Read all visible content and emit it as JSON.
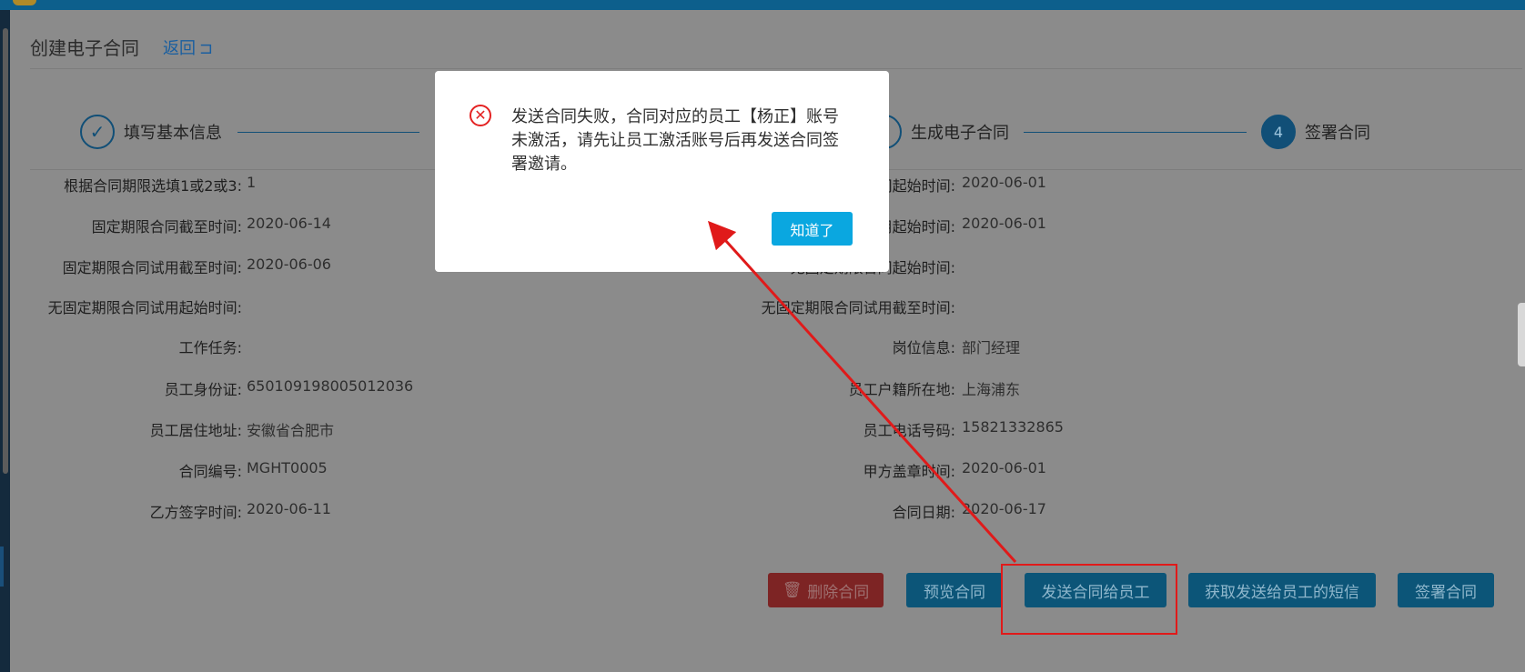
{
  "header": {
    "title": "创建电子合同",
    "back_label": "返回",
    "back_icon": "return-icon"
  },
  "steps": [
    {
      "label": "填写基本信息",
      "state": "done"
    },
    {
      "label": "生成电子合同",
      "state": "done"
    },
    {
      "label": "签署合同",
      "number": "4",
      "state": "active"
    }
  ],
  "form": {
    "left": [
      {
        "label": "根据合同期限选填1或2或3:",
        "value": "1"
      },
      {
        "label": "固定期限合同截至时间:",
        "value": "2020-06-14"
      },
      {
        "label": "固定期限合同试用截至时间:",
        "value": "2020-06-06"
      },
      {
        "label": "无固定期限合同试用起始时间:",
        "value": ""
      },
      {
        "label": "工作任务:",
        "value": ""
      },
      {
        "label": "员工身份证:",
        "value": "650109198005012036"
      },
      {
        "label": "员工居住地址:",
        "value": "安徽省合肥市"
      },
      {
        "label": "合同编号:",
        "value": "MGHT0005"
      },
      {
        "label": "乙方签字时间:",
        "value": "2020-06-11"
      }
    ],
    "right": [
      {
        "label": "期限合同起始时间:",
        "value": "2020-06-01"
      },
      {
        "label": "合同试用起始时间:",
        "value": "2020-06-01"
      },
      {
        "label": "无固定期限合同起始时间:",
        "value": ""
      },
      {
        "label": "无固定期限合同试用截至时间:",
        "value": ""
      },
      {
        "label": "岗位信息:",
        "value": "部门经理"
      },
      {
        "label": "员工户籍所在地:",
        "value": "上海浦东"
      },
      {
        "label": "员工电话号码:",
        "value": "15821332865"
      },
      {
        "label": "甲方盖章时间:",
        "value": "2020-06-01"
      },
      {
        "label": "合同日期:",
        "value": "2020-06-17"
      }
    ]
  },
  "buttons": {
    "delete": "删除合同",
    "preview": "预览合同",
    "send": "发送合同给员工",
    "get_sms": "获取发送给员工的短信",
    "sign": "签署合同"
  },
  "dialog": {
    "message": "发送合同失败，合同对应的员工【杨正】账号未激活，请先让员工激活账号后再发送合同签署邀请。",
    "confirm_label": "知道了",
    "icon": "error-icon"
  },
  "colors": {
    "error": "#e42222",
    "dialog_button": "#0aa7e0",
    "annotation": "#e01a1a"
  }
}
